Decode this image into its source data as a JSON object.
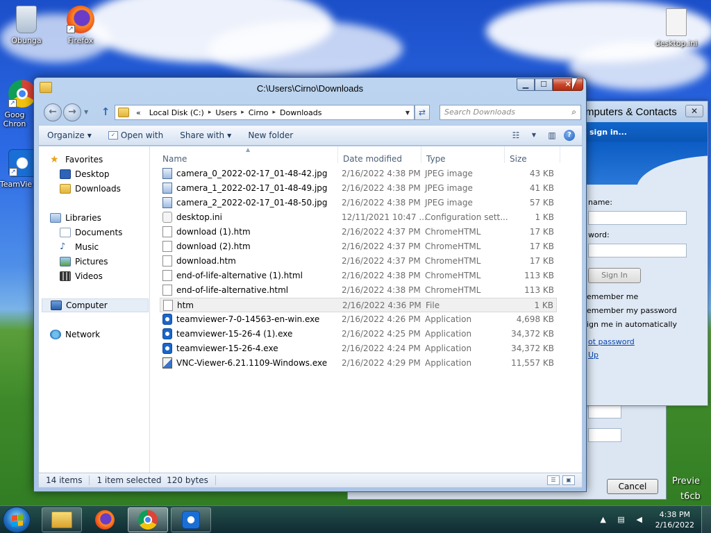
{
  "desktop": {
    "icons": [
      {
        "label": "Obunga"
      },
      {
        "label": "Firefox"
      },
      {
        "label": "Goog Chron"
      },
      {
        "label": "TeamVie"
      },
      {
        "label": "desktop.ini"
      }
    ]
  },
  "background_dialog": {
    "title": "mputers & Contacts",
    "banner": "sign in...",
    "username_label": "name:",
    "password_label": "word:",
    "signin_button": "Sign In",
    "remember_me": "emember me",
    "remember_password": "emember my password",
    "sign_in_auto": "ign me in automatically",
    "forgot_link": "ot password",
    "signup_link": "Up",
    "cancel_button": "Cancel",
    "preview_text_1": "Previe",
    "preview_text_2": "t6cb"
  },
  "explorer": {
    "title": "C:\\Users\\Cirno\\Downloads",
    "address": {
      "overflow": "«",
      "segments": [
        "Local Disk (C:)",
        "Users",
        "Cirno",
        "Downloads"
      ]
    },
    "search_placeholder": "Search Downloads",
    "toolbar": {
      "organize": "Organize",
      "open_with": "Open with",
      "share_with": "Share with",
      "new_folder": "New folder"
    },
    "nav_pane": {
      "favorites": "Favorites",
      "desktop": "Desktop",
      "downloads": "Downloads",
      "libraries": "Libraries",
      "documents": "Documents",
      "music": "Music",
      "pictures": "Pictures",
      "videos": "Videos",
      "computer": "Computer",
      "network": "Network"
    },
    "columns": {
      "name": "Name",
      "date": "Date modified",
      "type": "Type",
      "size": "Size"
    },
    "files": [
      {
        "name": "camera_0_2022-02-17_01-48-42.jpg",
        "date": "2/16/2022 4:38 PM",
        "type": "JPEG image",
        "size": "43 KB",
        "icon": "jpg"
      },
      {
        "name": "camera_1_2022-02-17_01-48-49.jpg",
        "date": "2/16/2022 4:38 PM",
        "type": "JPEG image",
        "size": "41 KB",
        "icon": "jpg"
      },
      {
        "name": "camera_2_2022-02-17_01-48-50.jpg",
        "date": "2/16/2022 4:38 PM",
        "type": "JPEG image",
        "size": "57 KB",
        "icon": "jpg"
      },
      {
        "name": "desktop.ini",
        "date": "12/11/2021 10:47 ...",
        "type": "Configuration sett...",
        "size": "1 KB",
        "icon": "ini"
      },
      {
        "name": "download (1).htm",
        "date": "2/16/2022 4:37 PM",
        "type": "ChromeHTML",
        "size": "17 KB",
        "icon": "doc"
      },
      {
        "name": "download (2).htm",
        "date": "2/16/2022 4:37 PM",
        "type": "ChromeHTML",
        "size": "17 KB",
        "icon": "doc"
      },
      {
        "name": "download.htm",
        "date": "2/16/2022 4:37 PM",
        "type": "ChromeHTML",
        "size": "17 KB",
        "icon": "doc"
      },
      {
        "name": "end-of-life-alternative (1).html",
        "date": "2/16/2022 4:38 PM",
        "type": "ChromeHTML",
        "size": "113 KB",
        "icon": "doc"
      },
      {
        "name": "end-of-life-alternative.html",
        "date": "2/16/2022 4:38 PM",
        "type": "ChromeHTML",
        "size": "113 KB",
        "icon": "doc"
      },
      {
        "name": "htm",
        "date": "2/16/2022 4:36 PM",
        "type": "File",
        "size": "1 KB",
        "icon": "doc",
        "selected": true
      },
      {
        "name": "teamviewer-7-0-14563-en-win.exe",
        "date": "2/16/2022 4:26 PM",
        "type": "Application",
        "size": "4,698 KB",
        "icon": "tv"
      },
      {
        "name": "teamviewer-15-26-4 (1).exe",
        "date": "2/16/2022 4:25 PM",
        "type": "Application",
        "size": "34,372 KB",
        "icon": "tv"
      },
      {
        "name": "teamviewer-15-26-4.exe",
        "date": "2/16/2022 4:24 PM",
        "type": "Application",
        "size": "34,372 KB",
        "icon": "tv"
      },
      {
        "name": "VNC-Viewer-6.21.1109-Windows.exe",
        "date": "2/16/2022 4:29 PM",
        "type": "Application",
        "size": "11,557 KB",
        "icon": "vnc"
      }
    ],
    "status": {
      "item_count": "14 items",
      "selection": "1 item selected  120 bytes"
    }
  },
  "taskbar": {
    "time": "4:38 PM",
    "date": "2/16/2022"
  },
  "colors": {
    "accent": "#1a66c9",
    "close_red": "#c7452a"
  }
}
